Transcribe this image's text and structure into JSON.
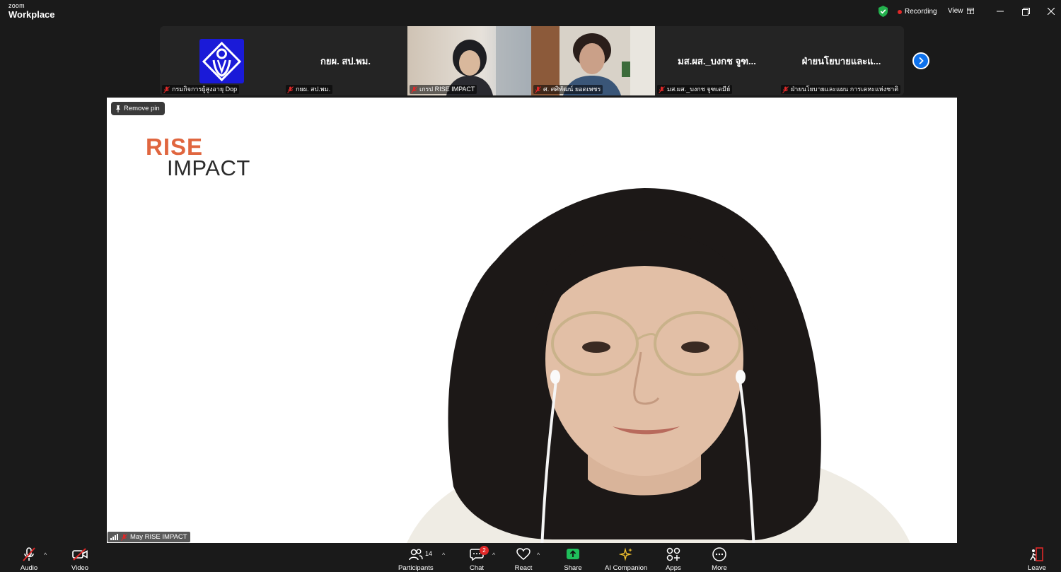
{
  "app": {
    "logo_small": "zoom",
    "logo_big": "Workplace"
  },
  "titlebar": {
    "recording_label": "Recording",
    "view_label": "View"
  },
  "thumbnails": [
    {
      "label": "กรมกิจการผู้สูงอายุ Dop",
      "center_name": ""
    },
    {
      "label": "กยผ. สป.พม.",
      "center_name": "กยผ. สป.พม."
    },
    {
      "label": "เกรป RISE IMPACT",
      "center_name": ""
    },
    {
      "label": "ศ. ศศิพัฒน์ ยอดเพชร",
      "center_name": ""
    },
    {
      "label": "มส.ผส._บงกช จูฑเดมีย์",
      "center_name": "มส.ผส._บงกช จูฑ..."
    },
    {
      "label": "ฝ่ายนโยบายและแผน การเคหะแห่งชาติ",
      "center_name": "ฝ่ายนโยบายและแ..."
    }
  ],
  "main": {
    "pin_label": "Remove pin",
    "brand_top": "RISE",
    "brand_bottom": "IMPACT",
    "speaker_name": "May RISE IMPACT"
  },
  "toolbar": {
    "audio": "Audio",
    "video": "Video",
    "participants": "Participants",
    "participants_count": "14",
    "chat": "Chat",
    "chat_badge": "2",
    "react": "React",
    "share": "Share",
    "ai_companion": "AI Companion",
    "apps": "Apps",
    "more": "More",
    "leave": "Leave"
  },
  "colors": {
    "accent_blue": "#0e72ed",
    "share_green": "#1fbf5b",
    "recording_red": "#e02828",
    "brand_orange": "#e0663f"
  }
}
